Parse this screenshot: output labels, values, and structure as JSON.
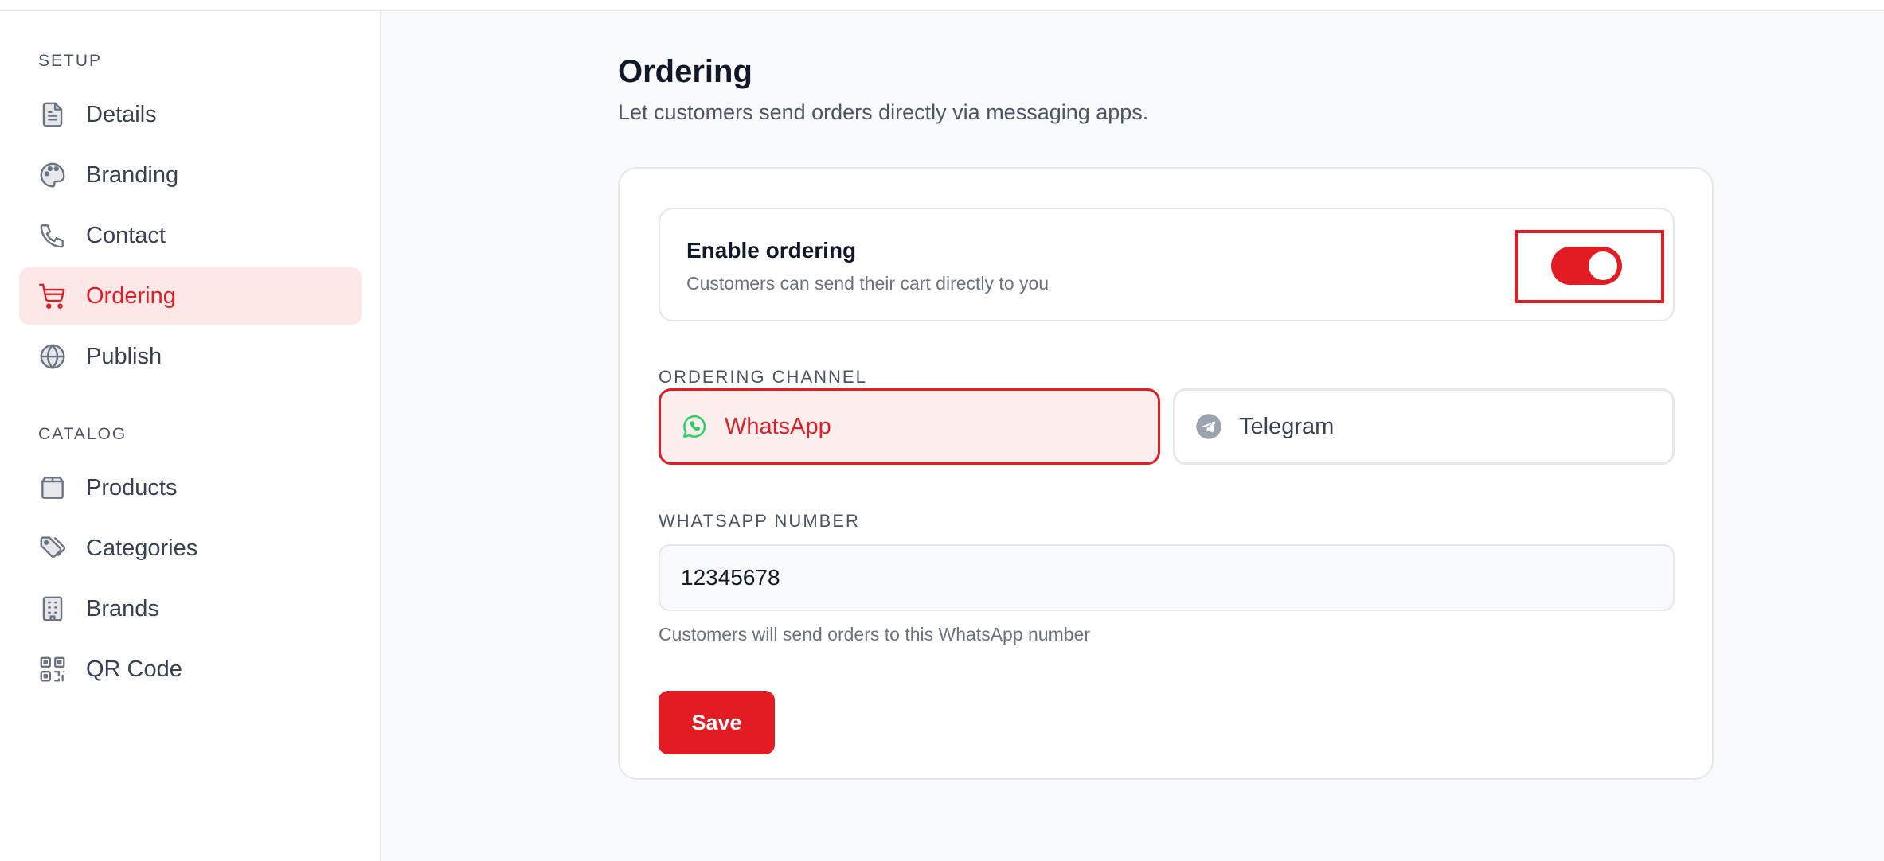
{
  "sidebar": {
    "sections": [
      {
        "label": "SETUP",
        "items": [
          {
            "label": "Details",
            "icon": "document-icon"
          },
          {
            "label": "Branding",
            "icon": "palette-icon"
          },
          {
            "label": "Contact",
            "icon": "phone-icon"
          },
          {
            "label": "Ordering",
            "icon": "cart-icon",
            "active": true
          },
          {
            "label": "Publish",
            "icon": "globe-icon"
          }
        ]
      },
      {
        "label": "CATALOG",
        "items": [
          {
            "label": "Products",
            "icon": "box-icon"
          },
          {
            "label": "Categories",
            "icon": "tags-icon"
          },
          {
            "label": "Brands",
            "icon": "building-icon"
          },
          {
            "label": "QR Code",
            "icon": "qr-code-icon"
          }
        ]
      }
    ]
  },
  "main": {
    "title": "Ordering",
    "subtitle": "Let customers send orders directly via messaging apps.",
    "enable": {
      "title": "Enable ordering",
      "description": "Customers can send their cart directly to you",
      "enabled": true
    },
    "channel": {
      "label": "ORDERING CHANNEL",
      "options": [
        {
          "label": "WhatsApp",
          "icon": "whatsapp-icon",
          "selected": true
        },
        {
          "label": "Telegram",
          "icon": "telegram-icon",
          "selected": false
        }
      ]
    },
    "number": {
      "label": "WHATSAPP NUMBER",
      "value": "12345678",
      "helper": "Customers will send orders to this WhatsApp number"
    },
    "save_label": "Save"
  },
  "colors": {
    "accent": "#e31b23",
    "accent_bg": "#fde8e8",
    "whatsapp": "#25d366",
    "telegram": "#9ca3af"
  }
}
